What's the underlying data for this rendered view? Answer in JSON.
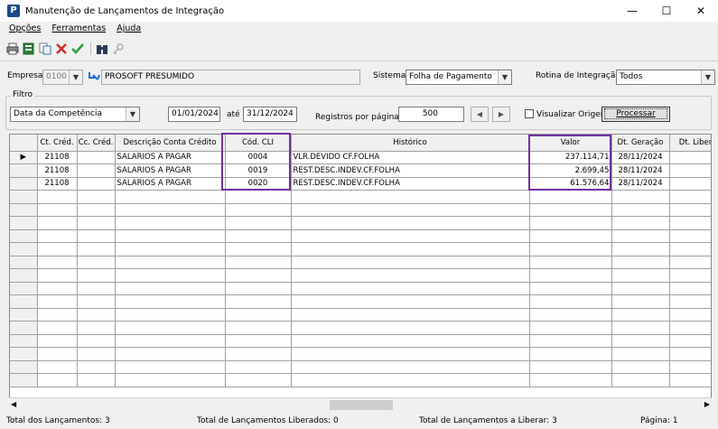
{
  "window": {
    "title": "Manutenção de Lançamentos de Integração",
    "app_icon": "P",
    "minimize": "—",
    "maximize": "☐",
    "close": "✕"
  },
  "menu": [
    "Opções",
    "Ferramentas",
    "Ajuda"
  ],
  "toolbar": {
    "icons": [
      "printer-icon",
      "export-icon",
      "copy-icon",
      "delete-icon",
      "confirm-icon",
      "binoculars-icon",
      "key-icon"
    ]
  },
  "header": {
    "empresa_label": "Empresa:",
    "empresa_code": "0100",
    "empresa_name": "PROSOFT PRESUMIDO",
    "sistema_label": "Sistema:",
    "sistema_value": "Folha de Pagamento",
    "rotina_label": "Rotina de Integração:",
    "rotina_value": "Todos"
  },
  "filtro": {
    "legend": "Filtro",
    "type": "Data da Competência",
    "date_from": "01/01/2024",
    "ate_label": "até",
    "date_to": "31/12/2024",
    "registros_label": "Registros por páginas:",
    "registros_value": "500",
    "visualizar_label": "Visualizar Origem",
    "processar_label": "Processar"
  },
  "grid": {
    "columns": [
      "",
      "Ct. Créd.",
      "Cc. Créd.",
      "Descrição Conta Crédito",
      "Cód. CLI",
      "Histórico",
      "Valor",
      "Dt. Geração",
      "Dt. Liber."
    ],
    "rows": [
      {
        "ct_cred": "21108",
        "cc_cred": "",
        "descricao": "SALARIOS A PAGAR",
        "cod_cli": "0004",
        "historico": "VLR.DEVIDO CF.FOLHA",
        "valor": "237.114,71",
        "dt_geracao": "28/11/2024",
        "dt_liber": ""
      },
      {
        "ct_cred": "21108",
        "cc_cred": "",
        "descricao": "SALARIOS A PAGAR",
        "cod_cli": "0019",
        "historico": "REST.DESC.INDEV.CF.FOLHA",
        "valor": "2.699,45",
        "dt_geracao": "28/11/2024",
        "dt_liber": ""
      },
      {
        "ct_cred": "21108",
        "cc_cred": "",
        "descricao": "SALARIOS A PAGAR",
        "cod_cli": "0020",
        "historico": "REST.DESC.INDEV.CF.FOLHA",
        "valor": "61.576,64",
        "dt_geracao": "28/11/2024",
        "dt_liber": ""
      }
    ],
    "empty_rows": 15,
    "highlight_color": "#7030a0"
  },
  "status": {
    "total": "Total dos Lançamentos: 3",
    "liberados": "Total de Lançamentos Liberados: 0",
    "a_liberar": "Total de Lançamentos a Liberar: 3",
    "pagina": "Página: 1"
  }
}
